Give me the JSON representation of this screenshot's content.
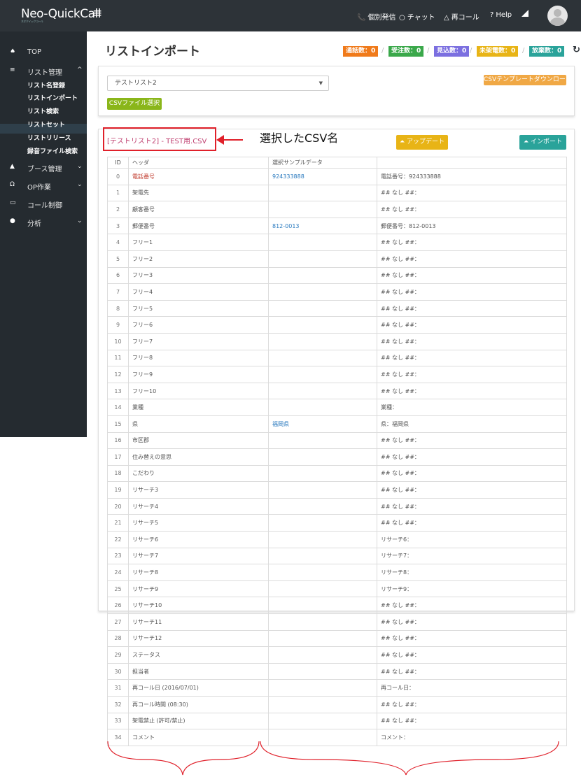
{
  "header": {
    "logo": "Neo-QuickCall",
    "logo_sub": "ネオクイックコール",
    "nav": [
      {
        "icon": "phone-icon",
        "glyph": "📞",
        "label": "個別発信"
      },
      {
        "icon": "chat-icon",
        "glyph": "○",
        "label": "チャット"
      },
      {
        "icon": "bell-icon",
        "glyph": "△",
        "label": "再コール"
      },
      {
        "icon": "help-icon",
        "glyph": "?",
        "label": "Help"
      }
    ]
  },
  "sidebar": {
    "items": [
      {
        "icon": "home-icon",
        "glyph": "♠",
        "label": "TOP"
      },
      {
        "icon": "list-icon",
        "glyph": "≡",
        "label": "リスト管理",
        "chevron": "^"
      },
      {
        "icon": "user-icon",
        "glyph": "▲",
        "label": "ブース管理",
        "chevron": "⌄"
      },
      {
        "icon": "headset-icon",
        "glyph": "Ω",
        "label": "OP作業",
        "chevron": "⌄"
      },
      {
        "icon": "monitor-icon",
        "glyph": "▭",
        "label": "コール制御"
      },
      {
        "icon": "chart-icon",
        "glyph": "●",
        "label": "分析",
        "chevron": "⌄"
      }
    ],
    "subitems": [
      "リスト名登録",
      "リストインポート",
      "リスト検索",
      "リストセット",
      "リストリリース",
      "録音ファイル検索"
    ]
  },
  "main": {
    "title": "リストインポート",
    "badges": [
      {
        "label": "通話数：0",
        "color": "#f07a1a"
      },
      {
        "label": "受注数：0",
        "color": "#3aa84a"
      },
      {
        "label": "見込数：0",
        "color": "#7b6fe0"
      },
      {
        "label": "未架電数：0",
        "color": "#e8b416"
      },
      {
        "label": "放棄数：0",
        "color": "#2aa39a"
      }
    ],
    "list_select": "テストリスト2",
    "csv_template_button": "CSVテンプレートダウンロード",
    "csv_select_button": "CSVファイル選択",
    "csv_name": "[テストリスト2] - TEST用.CSV",
    "annotation": "選択したCSV名",
    "update_button": "アップデート",
    "import_button": "インポート",
    "table": {
      "headers": [
        "ID",
        "ヘッダ",
        "選択サンプルデータ",
        ""
      ],
      "rows": [
        [
          "0",
          "電話番号",
          "924333888",
          "電話番号：924333888"
        ],
        [
          "1",
          "架電先",
          "",
          "## なし ##："
        ],
        [
          "2",
          "顧客番号",
          "",
          "## なし ##："
        ],
        [
          "3",
          "郵便番号",
          "812-0013",
          "郵便番号：812-0013"
        ],
        [
          "4",
          "フリー1",
          "",
          "## なし ##："
        ],
        [
          "5",
          "フリー2",
          "",
          "## なし ##："
        ],
        [
          "6",
          "フリー3",
          "",
          "## なし ##："
        ],
        [
          "7",
          "フリー4",
          "",
          "## なし ##："
        ],
        [
          "8",
          "フリー5",
          "",
          "## なし ##："
        ],
        [
          "9",
          "フリー6",
          "",
          "## なし ##："
        ],
        [
          "10",
          "フリー7",
          "",
          "## なし ##："
        ],
        [
          "11",
          "フリー8",
          "",
          "## なし ##："
        ],
        [
          "12",
          "フリー9",
          "",
          "## なし ##："
        ],
        [
          "13",
          "フリー10",
          "",
          "## なし ##："
        ],
        [
          "14",
          "業種",
          "",
          "業種："
        ],
        [
          "15",
          "県",
          "福岡県",
          "県：福岡県"
        ],
        [
          "16",
          "市区郡",
          "",
          "## なし ##："
        ],
        [
          "17",
          "住み替えの意思",
          "",
          "## なし ##："
        ],
        [
          "18",
          "こだわり",
          "",
          "## なし ##："
        ],
        [
          "19",
          "リサーチ3",
          "",
          "## なし ##："
        ],
        [
          "20",
          "リサーチ4",
          "",
          "## なし ##："
        ],
        [
          "21",
          "リサーチ5",
          "",
          "## なし ##："
        ],
        [
          "22",
          "リサーチ6",
          "",
          "リサーチ6："
        ],
        [
          "23",
          "リサーチ7",
          "",
          "リサーチ7："
        ],
        [
          "24",
          "リサーチ8",
          "",
          "リサーチ8："
        ],
        [
          "25",
          "リサーチ9",
          "",
          "リサーチ9："
        ],
        [
          "26",
          "リサーチ10",
          "",
          "## なし ##："
        ],
        [
          "27",
          "リサーチ11",
          "",
          "## なし ##："
        ],
        [
          "28",
          "リサーチ12",
          "",
          "## なし ##："
        ],
        [
          "29",
          "ステータス",
          "",
          "## なし ##："
        ],
        [
          "30",
          "担当者",
          "",
          "## なし ##："
        ],
        [
          "31",
          "再コール日 (2016/07/01)",
          "",
          "再コール日："
        ],
        [
          "32",
          "再コール時間 (08:30)",
          "",
          "## なし ##："
        ],
        [
          "33",
          "架電禁止 (許可/禁止)",
          "",
          "## なし ##："
        ],
        [
          "34",
          "コメント",
          "",
          "コメント："
        ]
      ]
    }
  }
}
